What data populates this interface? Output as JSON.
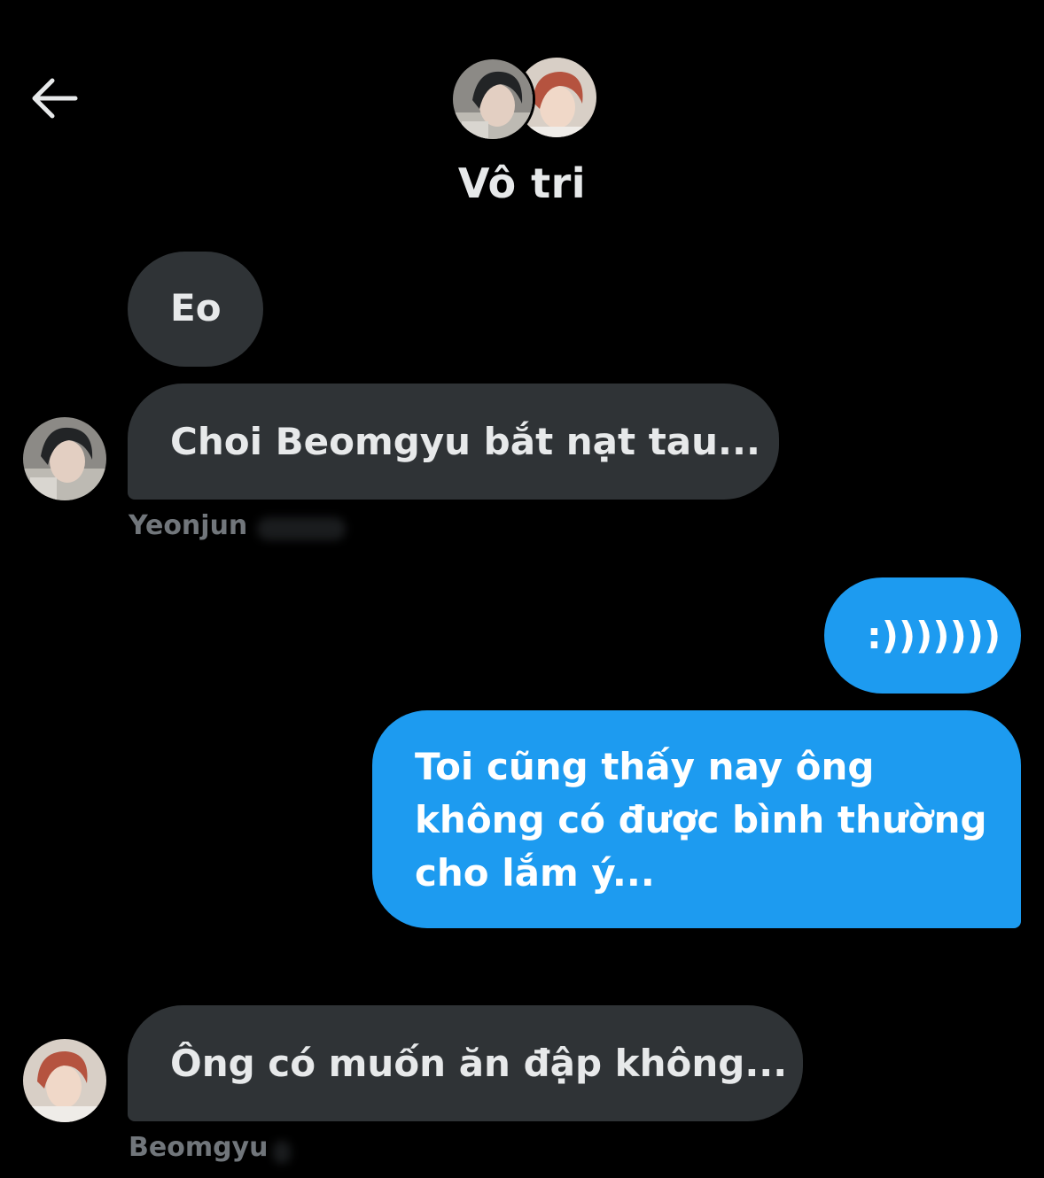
{
  "header": {
    "back_icon": "arrow-left-icon",
    "title": "Vô tri",
    "group_avatars": [
      "yeonjun-avatar",
      "beomgyu-avatar"
    ]
  },
  "messages": [
    {
      "direction": "incoming",
      "text": "Eo"
    },
    {
      "direction": "incoming",
      "text": "Choi Beomgyu bắt nạt tau...",
      "sender": "Yeonjun"
    },
    {
      "direction": "outgoing",
      "text": ":)))))))"
    },
    {
      "direction": "outgoing",
      "text": "Toi cũng thấy nay ông không có được bình thường cho lắm ý..."
    },
    {
      "direction": "incoming",
      "text": "Ông có muốn ăn đập không...",
      "sender": "Beomgyu"
    }
  ],
  "colors": {
    "background": "#000000",
    "incoming_bubble": "#2f3336",
    "outgoing_bubble": "#1d9bf0",
    "primary_text": "#e7e9ea",
    "secondary_text": "#71767b"
  }
}
